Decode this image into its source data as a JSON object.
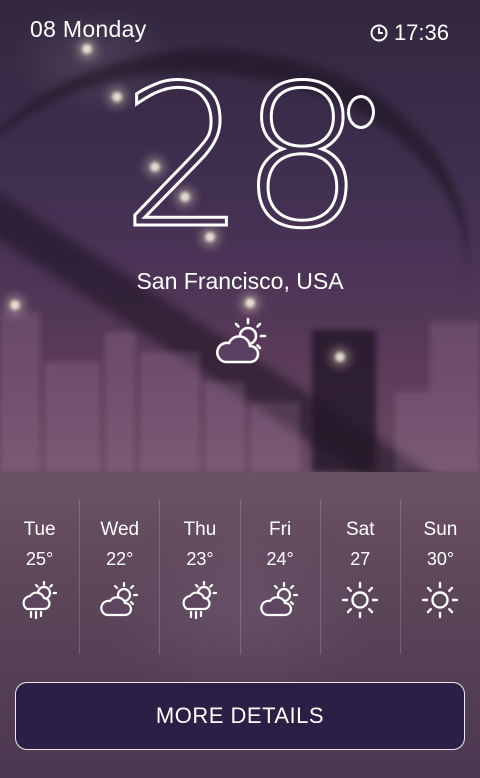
{
  "header": {
    "date": "08 Monday",
    "time": "17:36",
    "clock_icon": "clock-icon"
  },
  "current": {
    "temperature": "28",
    "location": "San Francisco, USA",
    "condition_icon": "partly-cloudy-icon"
  },
  "forecast": [
    {
      "day": "Tue",
      "temp": "25°",
      "icon": "rain-sun-icon"
    },
    {
      "day": "Wed",
      "temp": "22°",
      "icon": "partly-cloudy-icon"
    },
    {
      "day": "Thu",
      "temp": "23°",
      "icon": "rain-sun-icon"
    },
    {
      "day": "Fri",
      "temp": "24°",
      "icon": "partly-cloudy-icon"
    },
    {
      "day": "Sat",
      "temp": "27",
      "icon": "sun-icon"
    },
    {
      "day": "Sun",
      "temp": "30°",
      "icon": "sun-icon"
    }
  ],
  "actions": {
    "more_details_label": "MORE DETAILS"
  },
  "colors": {
    "text": "#ffffff",
    "button_bg": "#2b1f45",
    "hero_bg": "#3c2d4c"
  }
}
